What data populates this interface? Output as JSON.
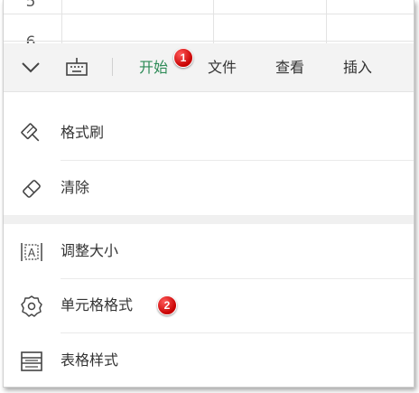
{
  "sheet": {
    "row_numbers": [
      "5",
      "6"
    ]
  },
  "toolbar": {
    "collapse_icon": "chevron-down-icon",
    "keyboard_icon": "keyboard-icon",
    "tabs": [
      {
        "label": "开始",
        "active": true
      },
      {
        "label": "文件",
        "active": false
      },
      {
        "label": "查看",
        "active": false
      },
      {
        "label": "插入",
        "active": false
      }
    ],
    "active_color": "#2e8b57"
  },
  "menu": {
    "section1": [
      {
        "label": "格式刷",
        "icon": "format-painter-icon"
      },
      {
        "label": "清除",
        "icon": "eraser-icon"
      }
    ],
    "section2": [
      {
        "label": "调整大小",
        "icon": "resize-icon"
      },
      {
        "label": "单元格格式",
        "icon": "gear-icon"
      },
      {
        "label": "表格样式",
        "icon": "table-style-icon"
      }
    ]
  },
  "annotations": {
    "badge1": "1",
    "badge2": "2",
    "badge_color": "#d10000"
  }
}
